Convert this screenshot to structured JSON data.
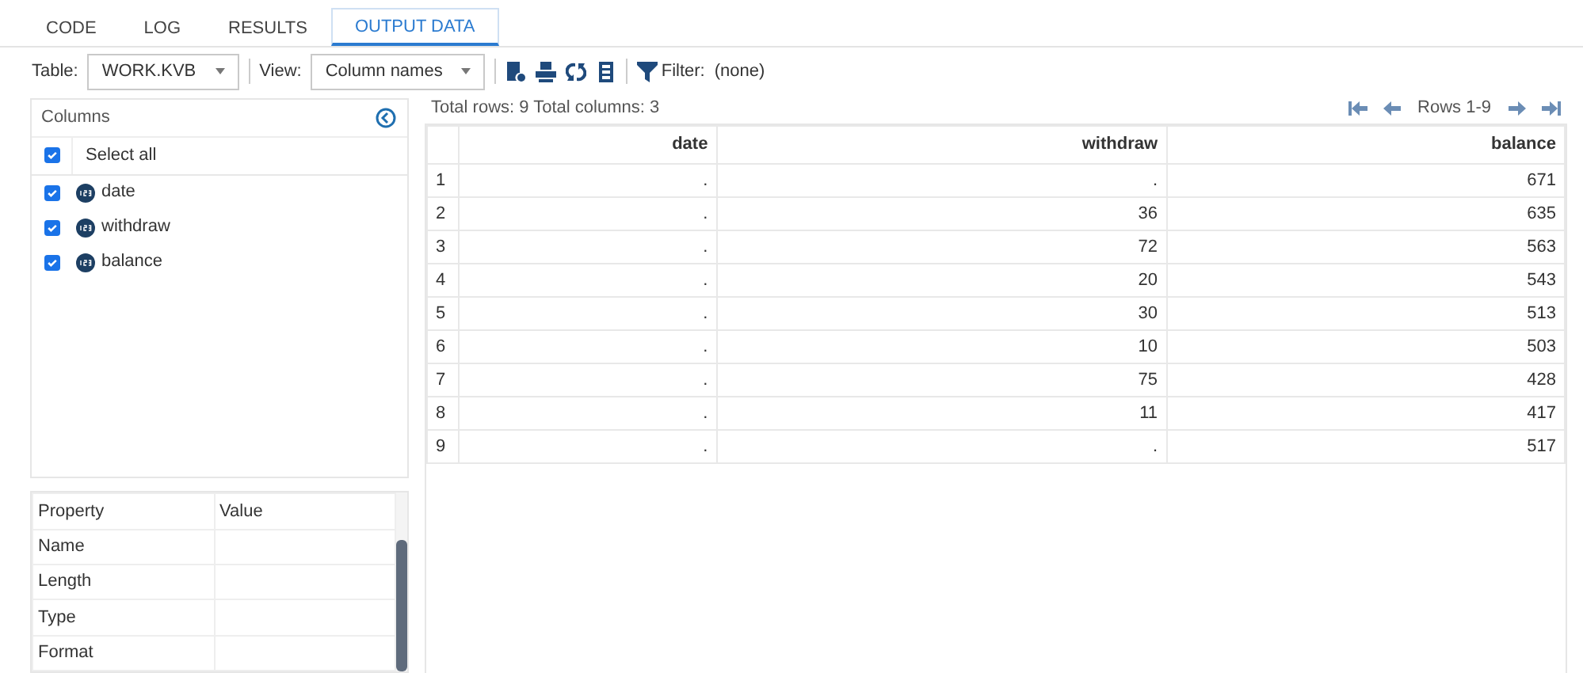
{
  "tabs": [
    {
      "label": "CODE",
      "selected": false
    },
    {
      "label": "LOG",
      "selected": false
    },
    {
      "label": "RESULTS",
      "selected": false
    },
    {
      "label": "OUTPUT DATA",
      "selected": true
    }
  ],
  "toolbar": {
    "table_label": "Table:",
    "table_value": "WORK.KVB",
    "view_label": "View:",
    "view_value": "Column names",
    "filter_label": "Filter:",
    "filter_value": "(none)"
  },
  "columns_panel": {
    "title": "Columns",
    "items": [
      {
        "label": "Select all",
        "checked": true,
        "kind": "all"
      },
      {
        "label": "date",
        "checked": true,
        "kind": "numeric"
      },
      {
        "label": "withdraw",
        "checked": true,
        "kind": "numeric"
      },
      {
        "label": "balance",
        "checked": true,
        "kind": "numeric"
      }
    ]
  },
  "properties": {
    "columns": [
      "Property",
      "Value"
    ],
    "rows": [
      "Name",
      "Length",
      "Type",
      "Format"
    ]
  },
  "grid": {
    "summary": "Total rows: 9  Total columns: 3",
    "pager": "Rows 1-9",
    "columns": [
      "",
      "date",
      "withdraw",
      "balance"
    ],
    "rows": [
      [
        "1",
        ".",
        ".",
        "671"
      ],
      [
        "2",
        ".",
        "36",
        "635"
      ],
      [
        "3",
        ".",
        "72",
        "563"
      ],
      [
        "4",
        ".",
        "20",
        "543"
      ],
      [
        "5",
        ".",
        "30",
        "513"
      ],
      [
        "6",
        ".",
        "10",
        "503"
      ],
      [
        "7",
        ".",
        "75",
        "428"
      ],
      [
        "8",
        ".",
        "11",
        "417"
      ],
      [
        "9",
        ".",
        ".",
        "517"
      ]
    ]
  }
}
